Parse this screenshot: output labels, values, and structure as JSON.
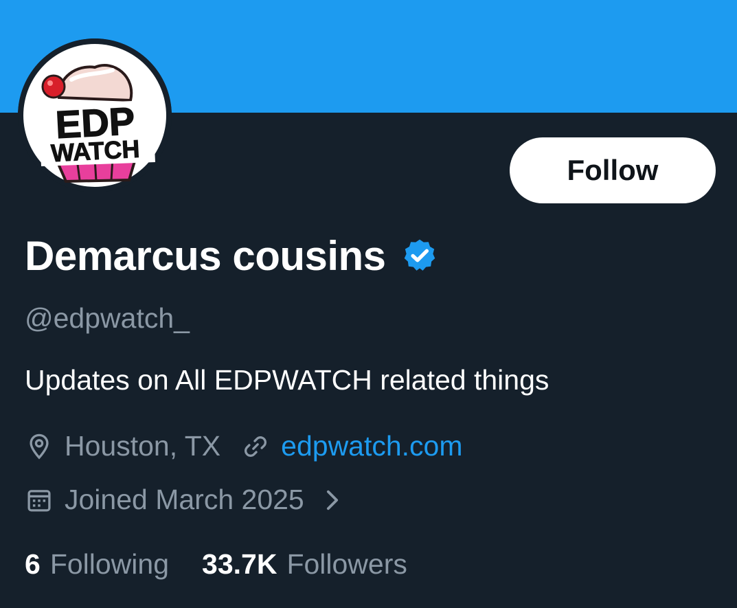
{
  "colors": {
    "banner": "#1d9bf0",
    "background": "#15202b",
    "primary_text": "#ffffff",
    "secondary_text": "#8b98a5",
    "link": "#1d9bf0",
    "verified_badge": "#1d9bf0"
  },
  "avatar": {
    "logo_text_line1": "EDP",
    "logo_text_line2": "WATCH"
  },
  "follow_button": {
    "label": "Follow"
  },
  "profile": {
    "display_name": "Demarcus cousins",
    "verified": true,
    "handle": "@edpwatch_",
    "bio": "Updates on All EDPWATCH related things",
    "location": "Houston, TX",
    "website": "edpwatch.com",
    "joined": "Joined March 2025"
  },
  "icons": {
    "location": "location-pin-icon",
    "link": "link-icon",
    "calendar": "calendar-icon",
    "chevron": "chevron-right-icon",
    "verified": "verified-badge-icon"
  },
  "stats": {
    "following_count": "6",
    "following_label": "Following",
    "followers_count": "33.7K",
    "followers_label": "Followers"
  }
}
